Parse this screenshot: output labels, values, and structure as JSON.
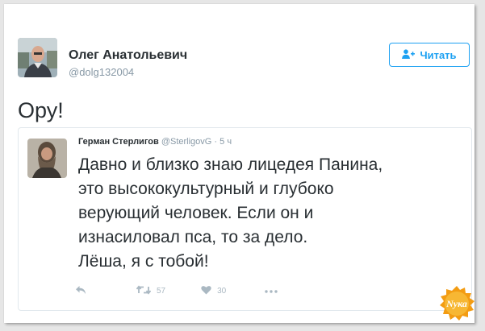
{
  "tweet": {
    "author_name": "Олег Анатольевич",
    "author_handle": "@dolg132004",
    "follow_label": "Читать",
    "text": "Ору!"
  },
  "quoted": {
    "author_name": "Герман Стерлигов",
    "author_handle": "@SterligovG",
    "separator": "·",
    "time": "5 ч",
    "lines": [
      "Давно и близко знаю лицедея Панина,",
      "это высококультурный и глубоко",
      "верующий человек. Если он и",
      "изнасиловал пса, то за дело.",
      "Лёша, я с тобой!"
    ],
    "retweet_count": "57",
    "like_count": "30"
  },
  "watermark": {
    "text": "Nука"
  },
  "colors": {
    "accent": "#1da1f2",
    "muted": "#8899a6",
    "icons": "#aab8c2",
    "watermark": "#f39c12"
  },
  "icons": [
    "follow-person-icon",
    "reply-icon",
    "retweet-icon",
    "like-icon",
    "more-icon"
  ]
}
